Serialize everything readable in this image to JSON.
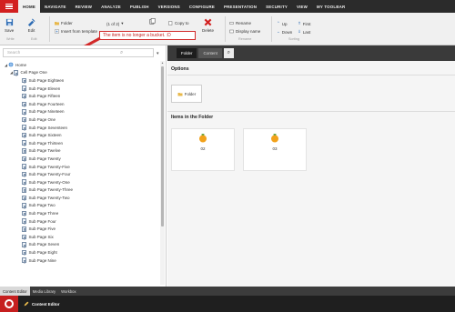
{
  "topbar": {
    "tabs": [
      "HOME",
      "NAVIGATE",
      "REVIEW",
      "ANALYZE",
      "PUBLISH",
      "VERSIONS",
      "CONFIGURE",
      "PRESENTATION",
      "SECURITY",
      "VIEW",
      "MY TOOLBAR"
    ]
  },
  "ribbon": {
    "save": "Save",
    "edit": "Edit",
    "group_write": "Write",
    "group_edit": "Edit",
    "insert_folder": "Folder",
    "insert_pager": "(1 of 2)",
    "insert_from_template": "Insert from template",
    "copy_to": "Copy to",
    "delete": "Delete",
    "rename": "Rename",
    "display_name": "Display name",
    "group_rename": "Rename",
    "up": "Up",
    "first": "First",
    "down": "Down",
    "last": "Last",
    "group_sorting": "Sorting"
  },
  "callout": "The item is no longer a bucket. :D",
  "tree": {
    "search_placeholder": "Search",
    "home": "Home",
    "parent": "Cell Page One",
    "children": [
      "Sub Page Eighteen",
      "Sub Page Eleven",
      "Sub Page Fifteen",
      "Sub Page Fourteen",
      "Sub Page Nineteen",
      "Sub Page One",
      "Sub Page Seventeen",
      "Sub Page Sixteen",
      "Sub Page Thirteen",
      "Sub Page Twelve",
      "Sub Page Twenty",
      "Sub Page Twenty-Five",
      "Sub Page Twenty-Four",
      "Sub Page Twenty-One",
      "Sub Page Twenty-Three",
      "Sub Page Twenty-Two",
      "Sub Page Two",
      "Sub Page Three",
      "Sub Page Four",
      "Sub Page Five",
      "Sub Page Six",
      "Sub Page Seven",
      "Sub Page Eight",
      "Sub Page Nine"
    ]
  },
  "right": {
    "tab_folder": "Folder",
    "tab_content": "Content",
    "options_title": "Options",
    "folder_button": "Folder",
    "items_title": "Items in the Folder",
    "cards": [
      "02",
      "03"
    ]
  },
  "bottom": {
    "tabs": [
      "Content Editor",
      "Media Library",
      "Workbox"
    ],
    "taskbar_item": "Content Editor"
  },
  "colors": {
    "accent": "#d21f1f",
    "callout_border": "#d22a2a"
  }
}
